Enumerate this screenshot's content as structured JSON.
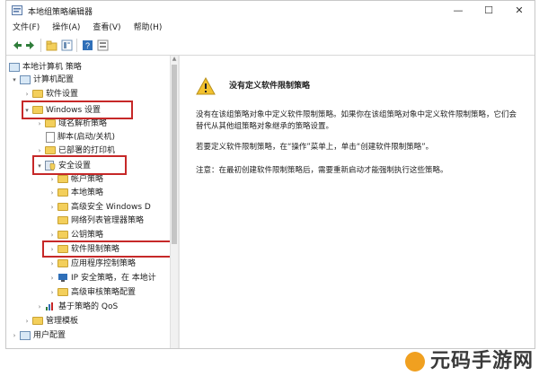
{
  "window": {
    "title": "本地组策略编辑器",
    "controls": {
      "minimize": "—",
      "maximize": "☐",
      "close": "✕"
    }
  },
  "menu": [
    "文件(F)",
    "操作(A)",
    "查看(V)",
    "帮助(H)"
  ],
  "toolbar": [
    "back-icon",
    "forward-icon",
    "show-tree-icon",
    "properties-icon",
    "help-icon",
    "view-icon"
  ],
  "tree": {
    "root": "本地计算机 策略",
    "computer_config": "计算机配置",
    "software_settings": "软件设置",
    "windows_settings": "Windows 设置",
    "name_resolution": "域名解析策略",
    "scripts": "脚本(启动/关机)",
    "deployed_printers": "已部署的打印机",
    "security_settings": "安全设置",
    "account_policies": "帐户策略",
    "local_policies": "本地策略",
    "firewall": "高级安全 Windows D",
    "network_list": "网络列表管理器策略",
    "public_key": "公钥策略",
    "software_restriction": "软件限制策略",
    "app_control": "应用程序控制策略",
    "ip_security": "IP 安全策略，在 本地计",
    "audit_config": "高级审核策略配置",
    "qos": "基于策略的 QoS",
    "admin_templates": "管理模板",
    "user_config": "用户配置"
  },
  "content": {
    "heading": "没有定义软件限制策略",
    "para1": "没有在该组策略对象中定义软件限制策略。如果你在该组策略对象中定义软件限制策略，它们会替代从其他组策略对象继承的策略设置。",
    "para2": "若要定义软件限制策略，在“操作”菜单上，单击“创建软件限制策略”。",
    "para3": "注意：在最初创建软件限制策略后，需要重新启动才能强制执行这些策略。"
  },
  "watermark": "元码手游网",
  "colors": {
    "highlight": "#c62828",
    "folder": "#f3cf5b",
    "warning": "#f2c12e"
  }
}
